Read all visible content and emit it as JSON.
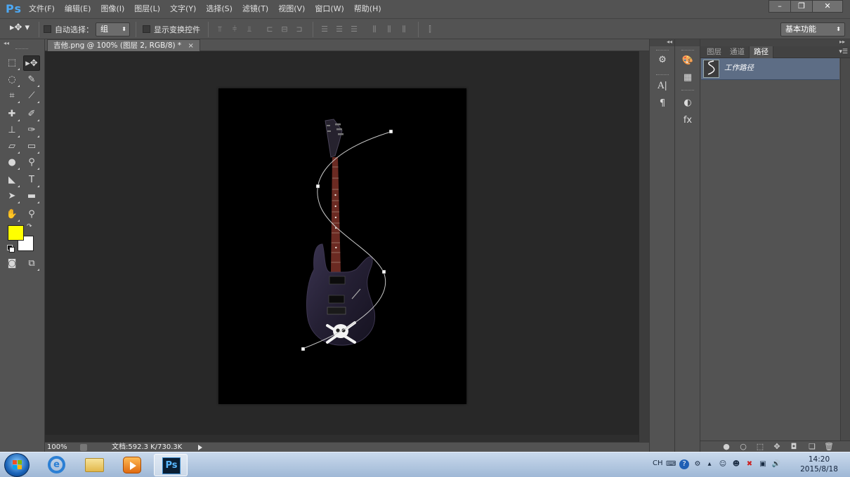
{
  "app": {
    "logo": "Ps"
  },
  "menu": {
    "items": [
      "文件(F)",
      "编辑(E)",
      "图像(I)",
      "图层(L)",
      "文字(Y)",
      "选择(S)",
      "滤镜(T)",
      "视图(V)",
      "窗口(W)",
      "帮助(H)"
    ]
  },
  "window_controls": {
    "minimize": "–",
    "restore": "❐",
    "close": "✕"
  },
  "options": {
    "auto_select_label": "自动选择：",
    "auto_select_value": "组",
    "show_transform_label": "显示变换控件",
    "workspace": "基本功能"
  },
  "document": {
    "tab_title": "吉他.png @ 100% (图层 2, RGB/8) *",
    "close": "×"
  },
  "colors": {
    "foreground": "#ffff00",
    "background": "#ffffff",
    "accent": "#4da9f5",
    "selected_row": "#5d6d85"
  },
  "status": {
    "zoom": "100%",
    "doc_size": "文档:592.3 K/730.3K"
  },
  "panel": {
    "tabs": [
      "图层",
      "通道",
      "路径"
    ],
    "active_tab": "路径",
    "path_item": "工作路径"
  },
  "taskbar": {
    "ps_label": "Ps",
    "ie_label": "e",
    "lang": "CH",
    "time": "14:20",
    "date": "2015/8/18"
  }
}
